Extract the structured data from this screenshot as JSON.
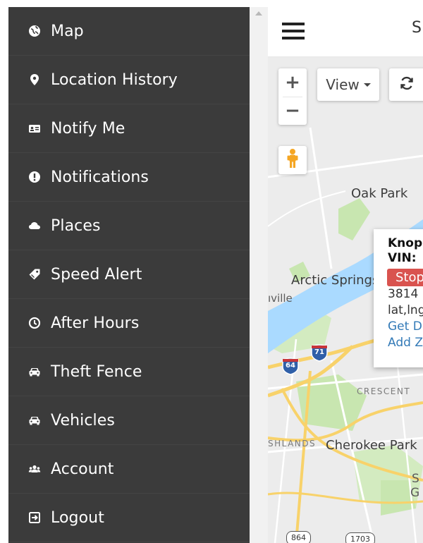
{
  "sidebar": {
    "items": [
      {
        "label": "Map",
        "icon": "globe-icon"
      },
      {
        "label": "Location History",
        "icon": "map-marker-icon"
      },
      {
        "label": "Notify Me",
        "icon": "id-card-icon"
      },
      {
        "label": "Notifications",
        "icon": "exclamation-circle-icon"
      },
      {
        "label": "Places",
        "icon": "cloud-icon"
      },
      {
        "label": "Speed Alert",
        "icon": "tag-icon"
      },
      {
        "label": "After Hours",
        "icon": "clock-icon"
      },
      {
        "label": "Theft Fence",
        "icon": "car-icon"
      },
      {
        "label": "Vehicles",
        "icon": "car-icon"
      },
      {
        "label": "Account",
        "icon": "users-icon"
      },
      {
        "label": "Logout",
        "icon": "sign-out-icon"
      }
    ]
  },
  "topbar": {
    "menu_icon": "hamburger-icon",
    "partial_text": "S"
  },
  "map": {
    "controls": {
      "zoom_in": "+",
      "zoom_out": "−",
      "view_label": "View",
      "refresh_icon": "refresh-icon",
      "pegman_icon": "pegman-icon"
    },
    "labels": {
      "oak_park": "Oak Park",
      "arctic_springs": "Arctic Springs",
      "ville": "ıville",
      "crescent": "CRESCENT",
      "highlands": "SHLANDS",
      "cherokee_park": "Cherokee Park",
      "right_s": "S",
      "right_g": "G"
    },
    "shields": {
      "interstate_71": "71",
      "interstate_64": "64",
      "route_864": "864",
      "route_1703": "1703"
    },
    "info_window": {
      "title": "Knop",
      "vin": "VIN:",
      "status": "Stop",
      "address": "3814",
      "latlng": "lat,lng",
      "directions_link": "Get D",
      "add_link": "Add Z"
    }
  },
  "colors": {
    "sidebar_bg": "#3b3b3b",
    "water": "#aadaff",
    "highway": "#f8d26a",
    "park": "#c8e6b0",
    "status_red": "#d9534f",
    "link_blue": "#337ab7"
  }
}
